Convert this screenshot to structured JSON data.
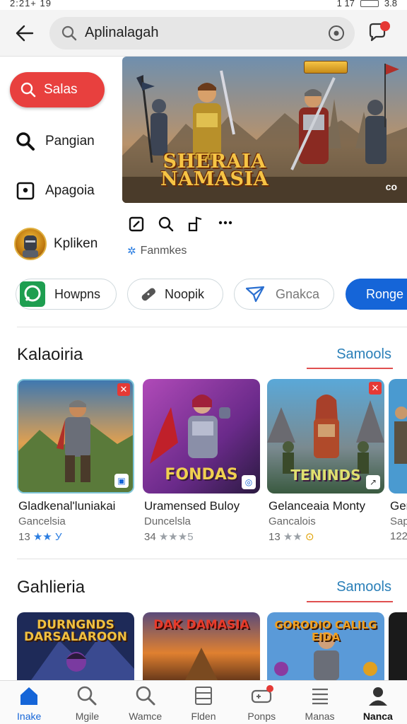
{
  "status_bar": {
    "time": "2:21+ 19",
    "signal": "1 17",
    "battery": "3.8"
  },
  "header": {
    "search_value": "Aplinalagah"
  },
  "sidebar": {
    "primary_label": "Salas",
    "items": [
      {
        "label": "Pangian",
        "icon": "search-icon"
      },
      {
        "label": "Apagoia",
        "icon": "square-dot-icon"
      },
      {
        "label": "Kpliken",
        "icon": "avatar"
      }
    ]
  },
  "banner": {
    "title_line1": "SHERAIA",
    "title_line2": "NAMASIA",
    "corner_text": "co",
    "favorite_label": "Fanmkes"
  },
  "chips": [
    "Howpns",
    "Noopik",
    "Gnakca",
    "Ronge"
  ],
  "section1": {
    "title": "Kalaoiria",
    "link": "Samools",
    "cards": [
      {
        "name": "Gladkenal'luniakai",
        "sub": "Gancelsia",
        "rating": "13",
        "stars": "★★",
        "tail": "У"
      },
      {
        "name": "Uramensed Buloy",
        "sub": "Duncelsla",
        "rating": "34",
        "stars": "★★★",
        "tail": "5",
        "art_title": "FONDAS"
      },
      {
        "name": "Gelanceaia Monty",
        "sub": "Gancalois",
        "rating": "13",
        "stars": "★★",
        "tail": "⊙",
        "art_title": "TENINDS"
      },
      {
        "name": "Ger",
        "sub": "Sap",
        "rating": "122"
      }
    ]
  },
  "section2": {
    "title": "Gahlieria",
    "link": "Samools",
    "cards": [
      {
        "art_title": "DURNGNDS DARSALAROON"
      },
      {
        "art_title": "DAK DAMASIA"
      },
      {
        "art_title": "GORODIO CALILG EIDA"
      }
    ]
  },
  "bottom_nav": [
    {
      "label": "Inake",
      "icon": "home-icon"
    },
    {
      "label": "Mgile",
      "icon": "search-icon"
    },
    {
      "label": "Wamce",
      "icon": "search-icon"
    },
    {
      "label": "Flden",
      "icon": "list-icon"
    },
    {
      "label": "Ponps",
      "icon": "gamepad-icon"
    },
    {
      "label": "Manas",
      "icon": "menu-icon"
    },
    {
      "label": "Nanca",
      "icon": "person-icon"
    }
  ],
  "colors": {
    "accent_red": "#e8403e",
    "accent_blue": "#1565d8",
    "link": "#2a7fb8"
  }
}
